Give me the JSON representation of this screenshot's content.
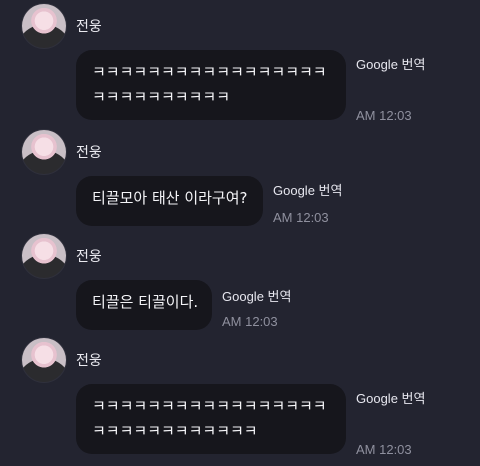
{
  "messages": [
    {
      "sender": "전웅",
      "lines": [
        "ㅋㅋㅋㅋㅋㅋㅋㅋㅋㅋㅋㅋㅋㅋㅋㅋㅋ",
        "ㅋㅋㅋㅋㅋㅋㅋㅋㅋㅋ"
      ],
      "translate_label": "Google 번역",
      "time": "AM 12:03"
    },
    {
      "sender": "전웅",
      "lines": [
        "티끌모아 태산 이라구여?"
      ],
      "translate_label": "Google 번역",
      "time": "AM 12:03"
    },
    {
      "sender": "전웅",
      "lines": [
        "티끌은 티끌이다."
      ],
      "translate_label": "Google 번역",
      "time": "AM 12:03"
    },
    {
      "sender": "전웅",
      "lines": [
        "ㅋㅋㅋㅋㅋㅋㅋㅋㅋㅋㅋㅋㅋㅋㅋㅋㅋ",
        "ㅋㅋㅋㅋㅋㅋㅋㅋㅋㅋㅋㅋ"
      ],
      "translate_label": "Google 번역",
      "time": "AM 12:03"
    }
  ]
}
